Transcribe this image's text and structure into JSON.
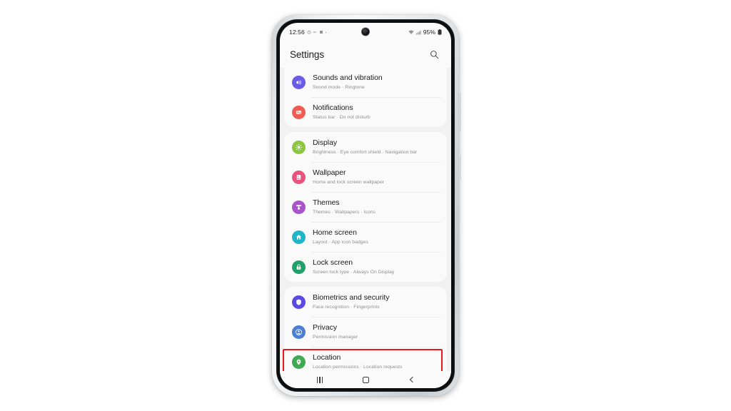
{
  "status_bar": {
    "clock": "12:56",
    "battery_percent": "95%",
    "icons": [
      "alarm-icon",
      "mute-icon",
      "dnd-icon",
      "dot-icon",
      "wifi-icon",
      "signal-icon",
      "battery-icon"
    ]
  },
  "header": {
    "title": "Settings",
    "search_icon": "search-icon"
  },
  "sections": [
    {
      "id": "sound-notifications",
      "rows": [
        {
          "title": "Sounds and vibration",
          "subtitle": "Sound mode  ·  Ringtone",
          "icon": "sound-icon",
          "color": "#6b5ce7"
        },
        {
          "title": "Notifications",
          "subtitle": "Status bar  ·  Do not disturb",
          "icon": "notification-icon",
          "color": "#ef5b52"
        }
      ]
    },
    {
      "id": "display-personalization",
      "rows": [
        {
          "title": "Display",
          "subtitle": "Brightness  ·  Eye comfort shield  ·  Navigation bar",
          "icon": "brightness-icon",
          "color": "#8cc63e"
        },
        {
          "title": "Wallpaper",
          "subtitle": "Home and lock screen wallpaper",
          "icon": "wallpaper-icon",
          "color": "#e8537f"
        },
        {
          "title": "Themes",
          "subtitle": "Themes  ·  Wallpapers  ·  Icons",
          "icon": "themes-icon",
          "color": "#a855c7"
        },
        {
          "title": "Home screen",
          "subtitle": "Layout  ·  App icon badges",
          "icon": "home-icon",
          "color": "#1fb6c9"
        },
        {
          "title": "Lock screen",
          "subtitle": "Screen lock type  ·  Always On Display",
          "icon": "lock-icon",
          "color": "#22a06b"
        }
      ]
    },
    {
      "id": "security-privacy",
      "rows": [
        {
          "title": "Biometrics and security",
          "subtitle": "Face recognition  ·  Fingerprints",
          "icon": "shield-icon",
          "color": "#5a4ae3",
          "highlighted": true
        },
        {
          "title": "Privacy",
          "subtitle": "Permission manager",
          "icon": "privacy-icon",
          "color": "#4a7fd4"
        },
        {
          "title": "Location",
          "subtitle": "Location permissions  ·  Location requests",
          "icon": "location-icon",
          "color": "#3faa52"
        }
      ]
    }
  ],
  "highlight": {
    "target": "Biometrics and security",
    "color": "#e8181c"
  },
  "nav_bar": {
    "recents_label": "recents-button",
    "home_label": "home-button",
    "back_label": "back-button"
  }
}
